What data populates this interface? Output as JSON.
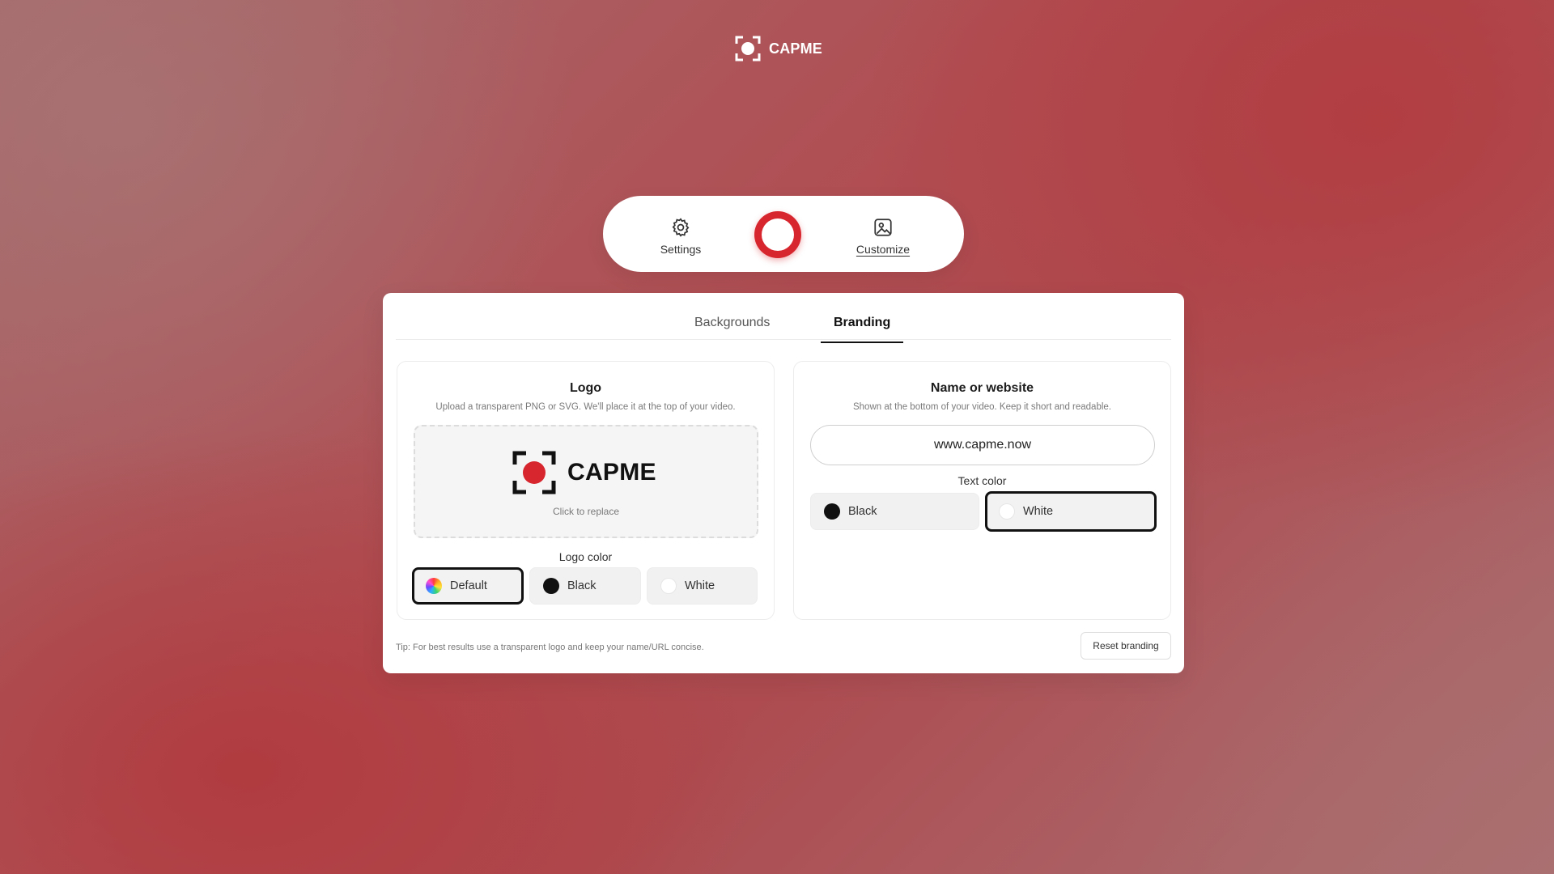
{
  "brand": {
    "name": "CAPME",
    "icon": "capture-record-icon"
  },
  "controls": {
    "settings_label": "Settings",
    "settings_icon": "gear-icon",
    "record_icon": "record-icon",
    "customize_label": "Customize",
    "customize_icon": "image-icon",
    "record_color": "#d7262e"
  },
  "tabs": [
    {
      "label": "Backgrounds",
      "active": false
    },
    {
      "label": "Branding",
      "active": true
    }
  ],
  "logo_panel": {
    "title": "Logo",
    "subtitle": "Upload a transparent PNG or SVG. We'll place it at the top of your video.",
    "preview_wordmark": "CAPME",
    "dropzone_hint": "Click to replace",
    "color_label": "Logo color",
    "color_options": [
      {
        "label": "Default",
        "swatch": "rainbow",
        "selected": true
      },
      {
        "label": "Black",
        "swatch": "#111111",
        "selected": false
      },
      {
        "label": "White",
        "swatch": "#ffffff",
        "selected": false
      }
    ]
  },
  "name_panel": {
    "title": "Name or website",
    "subtitle": "Shown at the bottom of your video. Keep it short and readable.",
    "input_value": "www.capme.now",
    "color_label": "Text color",
    "color_options": [
      {
        "label": "Black",
        "swatch": "#111111",
        "selected": false
      },
      {
        "label": "White",
        "swatch": "#ffffff",
        "selected": true
      }
    ]
  },
  "footer": {
    "tip": "Tip: For best results use a transparent logo and keep your name/URL concise.",
    "reset_label": "Reset branding"
  }
}
